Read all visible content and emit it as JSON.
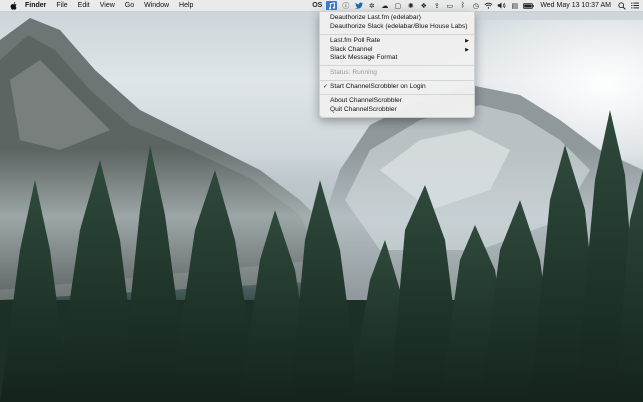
{
  "menubar": {
    "app_name": "Finder",
    "menus": [
      "File",
      "Edit",
      "View",
      "Go",
      "Window",
      "Help"
    ],
    "status_icons": [
      {
        "name": "os-status-icon",
        "glyph": "OS"
      },
      {
        "name": "channelscrobbler-icon",
        "glyph": "♫",
        "selected": true
      },
      {
        "name": "info-circle-icon",
        "glyph": "ⓘ"
      },
      {
        "name": "twitter-bird-icon",
        "glyph": "🐦"
      },
      {
        "name": "puzzle-icon",
        "glyph": "✲"
      },
      {
        "name": "cloud-icon",
        "glyph": "☁"
      },
      {
        "name": "message-icon",
        "glyph": "▢"
      },
      {
        "name": "bug-icon",
        "glyph": "✺"
      },
      {
        "name": "dropbox-icon",
        "glyph": "❖"
      },
      {
        "name": "share-icon",
        "glyph": "⇪"
      },
      {
        "name": "display-icon",
        "glyph": "▭"
      },
      {
        "name": "bluetooth-icon",
        "glyph": "ᛒ"
      },
      {
        "name": "time-machine-icon",
        "glyph": "◷"
      },
      {
        "name": "wifi-icon",
        "glyph": "◠"
      },
      {
        "name": "volume-icon",
        "glyph": "🔊"
      },
      {
        "name": "input-source-icon",
        "glyph": "▤"
      },
      {
        "name": "battery-icon",
        "glyph": "▬"
      }
    ],
    "clock": "Wed May 13  10:37 AM"
  },
  "dropdown": {
    "groups": [
      [
        {
          "label": "Deauthorize Last.fm (edelabar)"
        },
        {
          "label": "Deauthorize Slack (edelabar/Blue House Labs)"
        }
      ],
      [
        {
          "label": "Last.fm Poll Rate",
          "submenu": true
        },
        {
          "label": "Slack Channel",
          "submenu": true
        },
        {
          "label": "Slack Message Format"
        }
      ],
      [
        {
          "label": "Status: Running",
          "disabled": true
        }
      ],
      [
        {
          "label": "Start ChannelScrobbler on Login",
          "checked": true
        }
      ],
      [
        {
          "label": "About ChannelScrobbler"
        },
        {
          "label": "Quit ChannelScrobbler"
        }
      ]
    ]
  }
}
